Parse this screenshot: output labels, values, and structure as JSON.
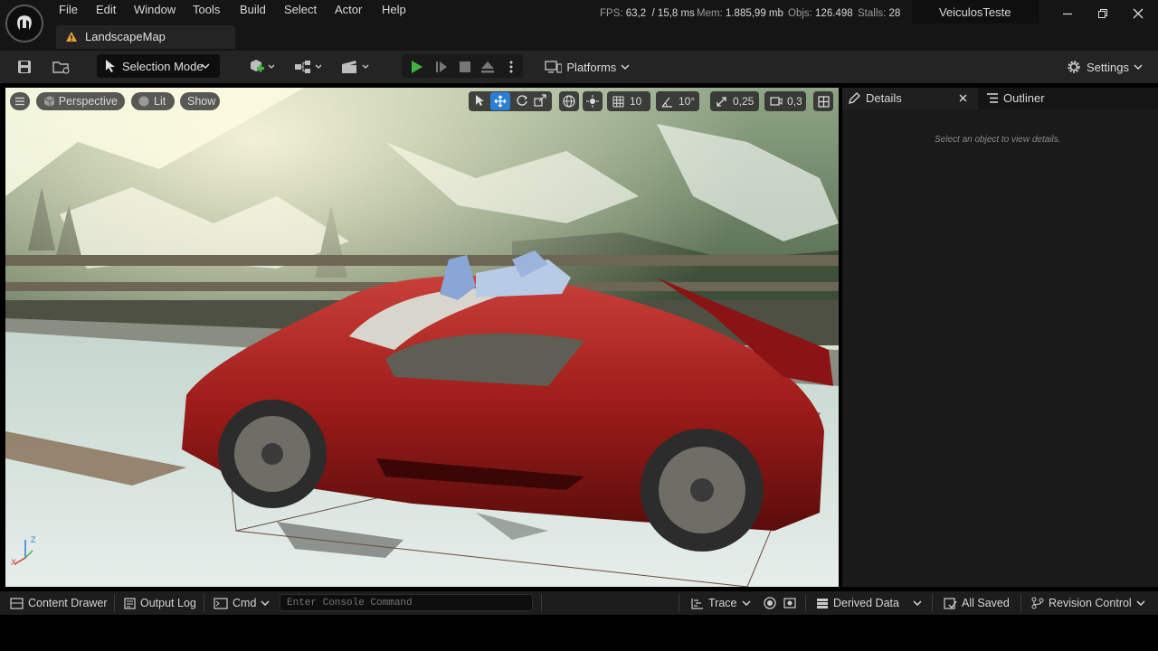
{
  "menu": [
    "File",
    "Edit",
    "Window",
    "Tools",
    "Build",
    "Select",
    "Actor",
    "Help"
  ],
  "map_tab": {
    "label": "LandscapeMap",
    "icon": "warning-icon"
  },
  "stats": {
    "fps_label": "FPS:",
    "fps_value": "63,2",
    "ms_value": "/ 15,8 ms",
    "mem_label": "Mem:",
    "mem_value": "1.885,99 mb",
    "objs_label": "Objs:",
    "objs_value": "126.498",
    "stalls_label": "Stalls:",
    "stalls_value": "28"
  },
  "project_name": "VeiculosTeste",
  "toolbar": {
    "mode_label": "Selection Mode",
    "platforms_label": "Platforms",
    "settings_label": "Settings"
  },
  "viewport": {
    "view_label": "Perspective",
    "lit_label": "Lit",
    "show_label": "Show",
    "grid_snap": "10",
    "rotation_snap": "10°",
    "scale_snap": "0,25",
    "camera_speed": "0,3",
    "axis_x": "X",
    "axis_z": "Z"
  },
  "panel": {
    "details_tab": "Details",
    "outliner_tab": "Outliner",
    "empty_message": "Select an object to view details."
  },
  "bottom": {
    "content_drawer": "Content Drawer",
    "output_log": "Output Log",
    "cmd_label": "Cmd",
    "console_placeholder": "Enter Console Command",
    "trace_label": "Trace",
    "derived_data": "Derived Data",
    "all_saved": "All Saved",
    "revision_control": "Revision Control"
  },
  "colors": {
    "accent_blue": "#2a7fd4",
    "play_green": "#3fb53f",
    "warning_orange": "#e8a33a",
    "car_red": "#b3221f"
  }
}
